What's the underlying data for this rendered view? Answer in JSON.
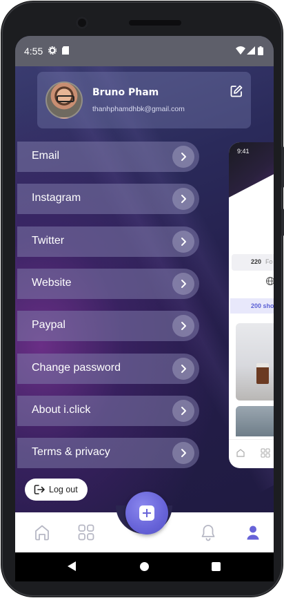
{
  "status_bar": {
    "time": "4:55"
  },
  "profile": {
    "name": "Bruno Pham",
    "email": "thanhphamdhbk@gmail.com"
  },
  "menu": {
    "items": [
      {
        "label": "Email"
      },
      {
        "label": "Instagram"
      },
      {
        "label": "Twitter"
      },
      {
        "label": "Website"
      },
      {
        "label": "Paypal"
      },
      {
        "label": "Change password"
      },
      {
        "label": "About i.click"
      },
      {
        "label": "Terms & privacy"
      }
    ]
  },
  "logout": {
    "label": "Log out"
  },
  "preview": {
    "time": "9:41",
    "stat_value": "220",
    "stat_label": "Fo",
    "shots_label": "200 sho"
  },
  "bottom_nav": {
    "items": [
      "home-icon",
      "grid-icon",
      "add-icon",
      "bell-icon",
      "user-icon"
    ],
    "active": "user-icon",
    "accent_color": "#6763d8"
  }
}
